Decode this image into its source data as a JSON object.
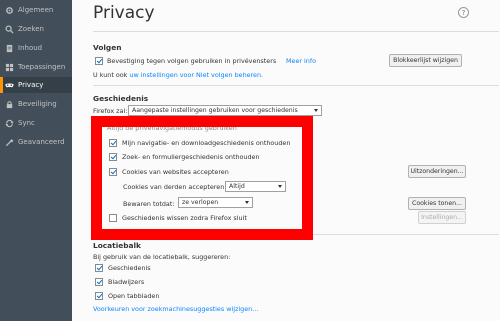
{
  "sidebar": {
    "items": [
      {
        "label": "Algemeen",
        "icon": "gear-icon"
      },
      {
        "label": "Zoeken",
        "icon": "search-icon"
      },
      {
        "label": "Inhoud",
        "icon": "document-icon"
      },
      {
        "label": "Toepassingen",
        "icon": "applications-icon"
      },
      {
        "label": "Privacy",
        "icon": "mask-icon"
      },
      {
        "label": "Beveiliging",
        "icon": "lock-icon"
      },
      {
        "label": "Sync",
        "icon": "sync-icon"
      },
      {
        "label": "Geavanceerd",
        "icon": "wizard-icon"
      }
    ],
    "active_index": 4
  },
  "page": {
    "title": "Privacy",
    "help": "?"
  },
  "tracking": {
    "heading": "Volgen",
    "dnt_label": "Bevestiging tegen volgen gebruiken in privévensters",
    "learn_more": "Meer info",
    "blocklist_button": "Blokkeerlijst wijzigen",
    "text_prefix": "U kunt ook",
    "manage_link": "uw instellingen voor Niet volgen beheren."
  },
  "history": {
    "heading": "Geschiedenis",
    "firefox_label": "Firefox zal:",
    "mode_select": "Aangepaste instellingen gebruiken voor geschiedenis",
    "subheader": "Altijd de privénavigatiemodus gebruiken",
    "remember_browsing": "Mijn navigatie- en downloadgeschiedenis onthouden",
    "remember_search": "Zoek- en formuliergeschiedenis onthouden",
    "accept_cookies": "Cookies van websites accepteren",
    "exceptions_button": "Uitzonderingen...",
    "third_party_label": "Cookies van derden accepteren:",
    "third_party_select": "Altijd",
    "keep_until_label": "Bewaren totdat:",
    "keep_until_select": "ze verlopen",
    "show_cookies_button": "Cookies tonen...",
    "clear_on_close": "Geschiedenis wissen zodra Firefox sluit",
    "settings_button": "Instellingen..."
  },
  "location_bar": {
    "heading": "Locatiebalk",
    "suggest_label": "Bij gebruik van de locatiebalk, suggereren:",
    "history": "Geschiedenis",
    "bookmarks": "Bladwijzers",
    "open_tabs": "Open tabbladen",
    "search_link": "Voorkeuren voor zoekmachinesuggesties wijzigen..."
  },
  "colors": {
    "sidebar_bg": "#424f5a",
    "accent": "#0a84ff",
    "highlight": "#ff0000"
  }
}
